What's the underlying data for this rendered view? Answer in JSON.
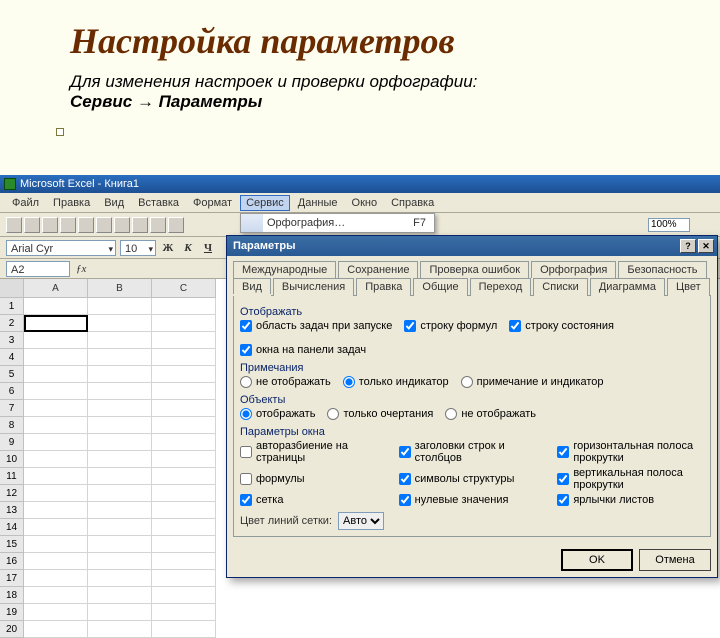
{
  "slide": {
    "title": "Настройка параметров",
    "subtitle_prefix": "Для изменения настроек и проверки орфографии:",
    "subtitle_bold": "Сервис → Параметры"
  },
  "excel": {
    "title": "Microsoft Excel - Книга1",
    "menu": [
      "Файл",
      "Правка",
      "Вид",
      "Вставка",
      "Формат",
      "Сервис",
      "Данные",
      "Окно",
      "Справка"
    ],
    "active_menu": 5,
    "dropdown": {
      "item": "Орфография…",
      "shortcut": "F7"
    },
    "zoom": "100%",
    "font": "Arial Cyr",
    "size": "10",
    "fmt": [
      "Ж",
      "К",
      "Ч"
    ],
    "namebox": "A2",
    "cols": [
      "A",
      "B",
      "C"
    ],
    "rows": 20
  },
  "dialog": {
    "title": "Параметры",
    "tabs_top": [
      "Международные",
      "Сохранение",
      "Проверка ошибок",
      "Орфография",
      "Безопасность"
    ],
    "tabs_bot": [
      "Вид",
      "Вычисления",
      "Правка",
      "Общие",
      "Переход",
      "Списки",
      "Диаграмма",
      "Цвет"
    ],
    "active_tab": "Вид",
    "groups": {
      "display": {
        "title": "Отображать",
        "items": [
          {
            "label": "область задач при запуске",
            "checked": true
          },
          {
            "label": "строку формул",
            "checked": true
          },
          {
            "label": "строку состояния",
            "checked": true
          },
          {
            "label": "окна на панели задач",
            "checked": true
          }
        ]
      },
      "notes": {
        "title": "Примечания",
        "items": [
          {
            "label": "не отображать",
            "checked": false
          },
          {
            "label": "только индикатор",
            "checked": true
          },
          {
            "label": "примечание и индикатор",
            "checked": false
          }
        ]
      },
      "objects": {
        "title": "Объекты",
        "items": [
          {
            "label": "отображать",
            "checked": true
          },
          {
            "label": "только очертания",
            "checked": false
          },
          {
            "label": "не отображать",
            "checked": false
          }
        ]
      },
      "window": {
        "title": "Параметры окна",
        "items": [
          {
            "label": "авторазбиение на страницы",
            "checked": false
          },
          {
            "label": "заголовки строк и столбцов",
            "checked": true
          },
          {
            "label": "горизонтальная полоса прокрутки",
            "checked": true
          },
          {
            "label": "формулы",
            "checked": false
          },
          {
            "label": "символы структуры",
            "checked": true
          },
          {
            "label": "вертикальная полоса прокрутки",
            "checked": true
          },
          {
            "label": "сетка",
            "checked": true
          },
          {
            "label": "нулевые значения",
            "checked": true
          },
          {
            "label": "ярлычки листов",
            "checked": true
          }
        ]
      }
    },
    "grid_color_label": "Цвет линий сетки:",
    "grid_color_value": "Авто",
    "ok": "OK",
    "cancel": "Отмена"
  }
}
